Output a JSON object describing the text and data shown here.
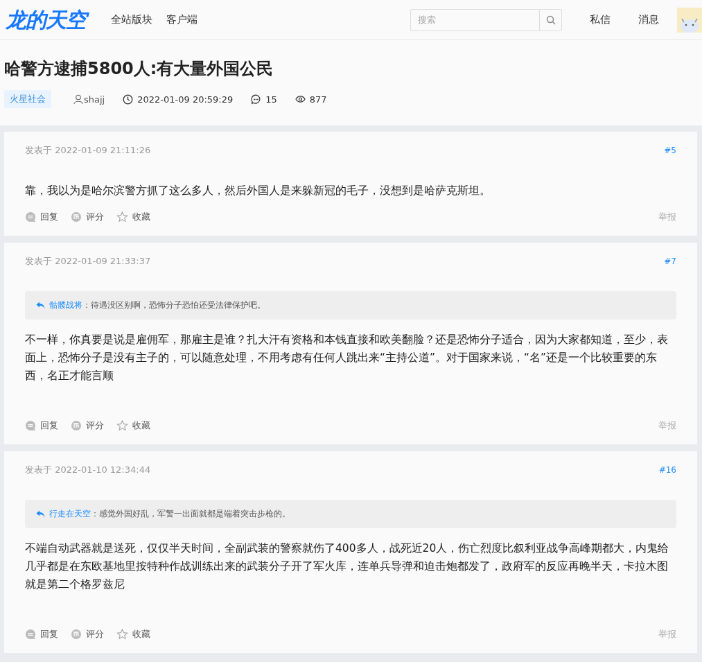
{
  "header": {
    "logo": "龙的天空",
    "nav": [
      "全站版块",
      "客户端"
    ],
    "search": {
      "placeholder": "搜索"
    },
    "links": [
      "私信",
      "消息"
    ]
  },
  "thread": {
    "title": "哈警方逮捕5800人:有大量外国公民",
    "tag": "火星社会",
    "author": "shajj",
    "time": "2022-01-09 20:59:29",
    "replies": "15",
    "views": "877"
  },
  "posts": [
    {
      "time": "发表于 2022-01-09 21:11:26",
      "floor": "#5",
      "content": "靠，我以为是哈尔滨警方抓了这么多人，然后外国人是来躲新冠的毛子，没想到是哈萨克斯坦。",
      "actions": [
        "回复",
        "评分",
        "收藏"
      ],
      "report": "举报"
    },
    {
      "time": "发表于 2022-01-09 21:33:37",
      "floor": "#7",
      "quote": {
        "author": "骷髅战将",
        "text": "：待遇没区别啊，恐怖分子恐怕还受法律保护吧。"
      },
      "content": "不一样，你真要是说是雇佣军，那雇主是谁？扎大汗有资格和本钱直接和欧美翻脸？还是恐怖分子适合，因为大家都知道，至少，表面上，恐怖分子是没有主子的，可以随意处理，不用考虑有任何人跳出来“主持公道”。对于国家来说，“名”还是一个比较重要的东西，名正才能言顺",
      "actions": [
        "回复",
        "评分",
        "收藏"
      ],
      "report": "举报"
    },
    {
      "time": "发表于 2022-01-10 12:34:44",
      "floor": "#16",
      "quote": {
        "author": "行走在天空",
        "text": "：感觉外国好乱，军警一出面就都是端着突击步枪的。"
      },
      "content": "不端自动武器就是送死，仅仅半天时间，全副武装的警察就伤了400多人，战死近20人，伤亡烈度比叙利亚战争高峰期都大，内鬼给几乎都是在东欧基地里按特种作战训练出来的武装分子开了军火库，连单兵导弹和迫击炮都发了，政府军的反应再晚半天，卡拉木图就是第二个格罗兹尼",
      "actions": [
        "回复",
        "评分",
        "收藏"
      ],
      "report": "举报"
    }
  ]
}
